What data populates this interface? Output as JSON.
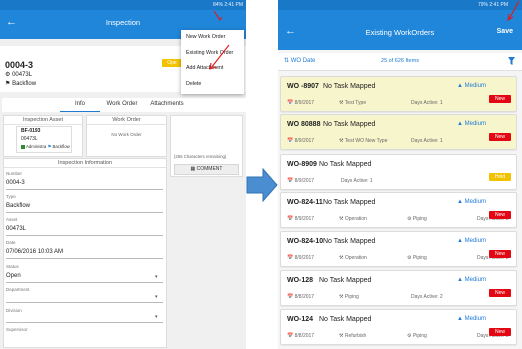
{
  "left_screen": {
    "status_bar": "84% 2:41 PM",
    "title": "Inspection",
    "record_id": "0004-3",
    "asset": "00473L",
    "type": "Backflow",
    "status_badge": "Ope",
    "menu": [
      "New Work Order",
      "Existing Work Order",
      "Add Attachment",
      "Delete"
    ],
    "tabs": [
      "Info",
      "Work Order",
      "Attachments"
    ],
    "inspection_asset": {
      "title": "Inspection Asset",
      "id": "BF-0193",
      "asset": "00473L",
      "tags": [
        "Administra",
        "Backflow"
      ]
    },
    "work_order_panel": {
      "title": "Work Order",
      "empty": "No Work Order"
    },
    "char_remaining": "(256 Characters remaining)",
    "comment_label": "COMMENT",
    "info_panel_title": "Inspection Information",
    "fields": [
      {
        "label": "Number",
        "value": "0004-3"
      },
      {
        "label": "Type",
        "value": "Backflow"
      },
      {
        "label": "Asset",
        "value": "00473L"
      },
      {
        "label": "Date",
        "value": "07/06/2016 10:03 AM"
      },
      {
        "label": "Status",
        "value": "Open"
      },
      {
        "label": "Department",
        "value": ""
      },
      {
        "label": "Division",
        "value": ""
      },
      {
        "label": "Supervisor",
        "value": ""
      }
    ]
  },
  "right_screen": {
    "status_bar": "79% 2:41 PM",
    "title": "Existing WorkOrders",
    "save_label": "Save",
    "sort_label": "WO Date",
    "count_label": "25 of 626 Items",
    "colors": {
      "header": "#2086da",
      "new": "#e30613",
      "hold": "#f2c200",
      "highlight": "#f7f5cc"
    },
    "work_orders": [
      {
        "id": "WO -8907",
        "task": "No Task Mapped",
        "priority": "Medium",
        "date": "8/9/2017",
        "type": "Test Type",
        "asset": "",
        "days": "Days Active: 1",
        "badge": "New",
        "highlight": true
      },
      {
        "id": "WO 80888",
        "task": "No Task Mapped",
        "priority": "Medium",
        "date": "8/9/2017",
        "type": "Test WO New Type",
        "asset": "",
        "days": "Days Active: 1",
        "badge": "New",
        "highlight": true
      },
      {
        "id": "WO-8909",
        "task": "No Task Mapped",
        "priority": "",
        "date": "8/9/2017",
        "type": "",
        "asset": "",
        "days": "Days Active: 1",
        "badge": "Hold",
        "highlight": false
      },
      {
        "id": "WO-824-11",
        "task": "No Task Mapped",
        "priority": "Medium",
        "date": "8/9/2017",
        "type": "Operation",
        "asset": "Piping",
        "days": "Days Active: 2",
        "badge": "New",
        "highlight": false
      },
      {
        "id": "WO-824-10",
        "task": "No Task Mapped",
        "priority": "Medium",
        "date": "8/9/2017",
        "type": "Operation",
        "asset": "Piping",
        "days": "Days Active: 2",
        "badge": "New",
        "highlight": false
      },
      {
        "id": "WO-128",
        "task": "No Task Mapped",
        "priority": "Medium",
        "date": "8/8/2017",
        "type": "Piping",
        "asset": "",
        "days": "Days Active: 2",
        "badge": "New",
        "highlight": false
      },
      {
        "id": "WO-124",
        "task": "No Task Mapped",
        "priority": "Medium",
        "date": "8/8/2017",
        "type": "Refurbish",
        "asset": "Piping",
        "days": "Days Active: 2",
        "badge": "New",
        "highlight": false
      }
    ]
  }
}
